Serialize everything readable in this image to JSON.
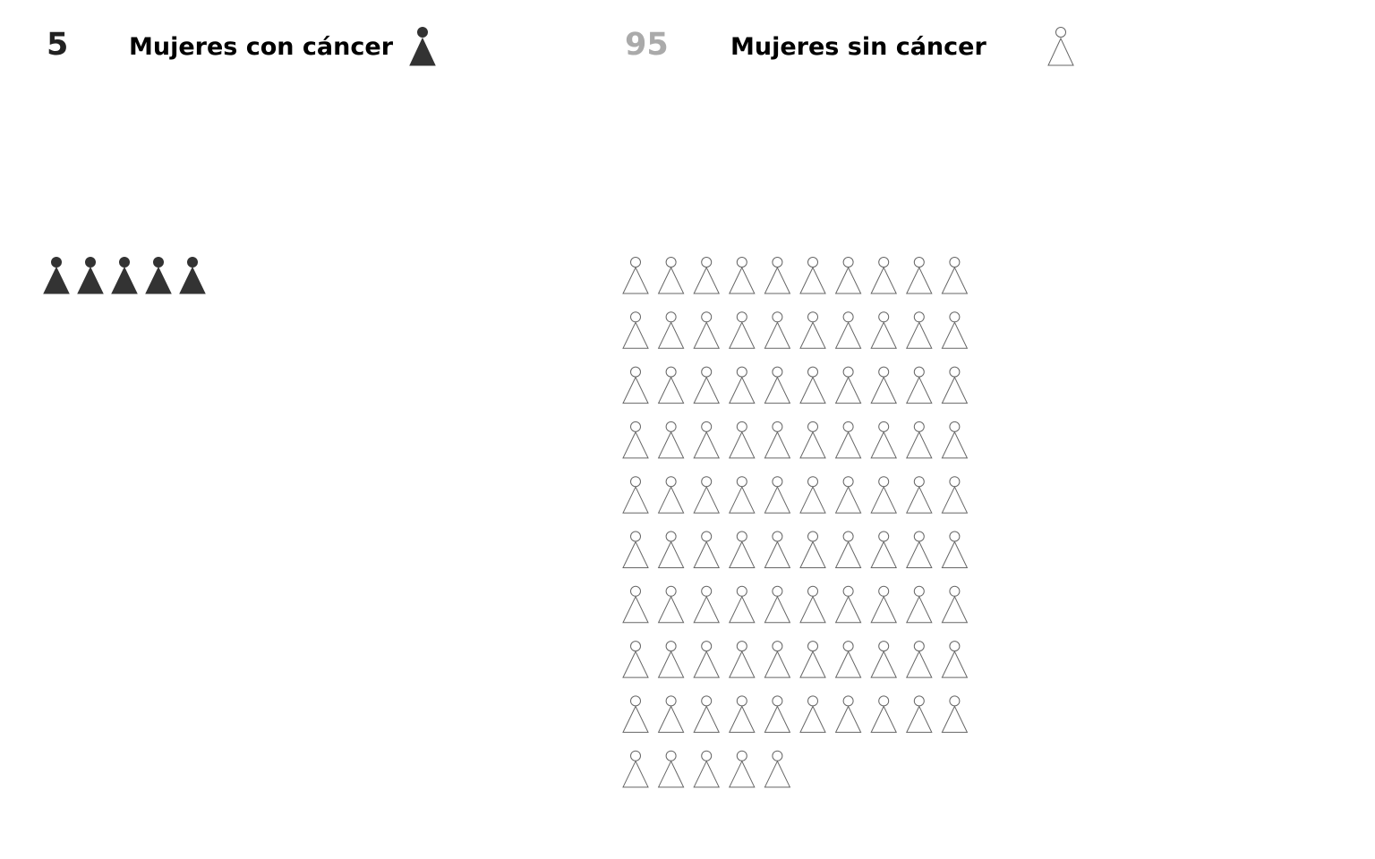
{
  "chart_data": {
    "type": "pictograph",
    "groups": [
      {
        "count": 5,
        "label": "Mujeres con cáncer",
        "icon": "filled-person-icon",
        "color": "#333333",
        "count_color": "#222222"
      },
      {
        "count": 95,
        "label": "Mujeres sin cáncer",
        "icon": "outline-person-icon",
        "color": "#666666",
        "count_color": "#aaaaaa"
      }
    ],
    "icons_per_row": 10
  }
}
